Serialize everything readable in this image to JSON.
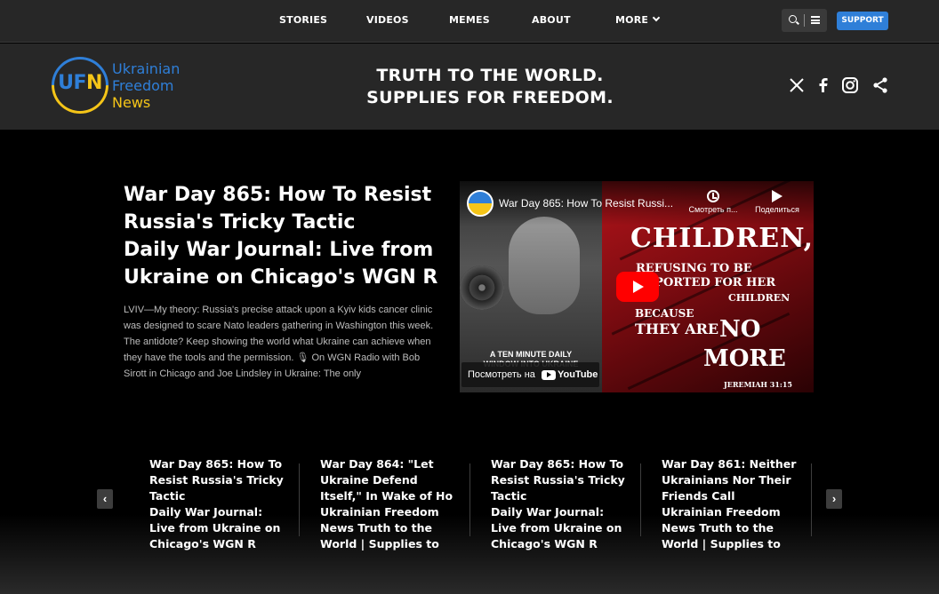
{
  "topnav": {
    "items": [
      "STORIES",
      "VIDEOS",
      "MEMES",
      "ABOUT",
      "MORE"
    ],
    "support_label": "SUPPORT"
  },
  "header": {
    "logo": {
      "initials_1": "U",
      "initials_2": "F",
      "initials_3": "N",
      "line1": "Ukrainian",
      "line2": "Freedom",
      "line3": "News"
    },
    "tagline_line1": "TRUTH TO THE WORLD.",
    "tagline_line2": "SUPPLIES FOR FREEDOM.",
    "social": [
      "x-icon",
      "facebook-icon",
      "instagram-icon",
      "share-icon"
    ]
  },
  "hero": {
    "title_lines": [
      "War Day 865: How To Resist",
      "Russia's Tricky Tactic",
      "Daily War Journal: Live from",
      "Ukraine on Chicago's WGN R"
    ],
    "body": "LVIV—My theory: Russia's precise attack upon a Kyiv kids cancer clinic was designed to scare Nato leaders gathering in Washington this week. The antidote? Keep showing the world what Ukraine can achieve when they have the tools and the permission. 🎙 On WGN Radio with Bob Sirott in Chicago and Joe Lindsley in Ukraine: The only"
  },
  "video": {
    "title": "War Day 865: How To Resist Russi...",
    "watch_later": "Смотреть п...",
    "share": "Поделиться",
    "watch_on": "Посмотреть на",
    "youtube_word": "YouTube",
    "left_caption_1": "A TEN MINUTE DAILY",
    "left_caption_2": "WINDOW INTO UKRAINE",
    "poster": {
      "p1": "CHILDREN,",
      "p2": "REFUSING TO BE",
      "p3": "DEPORTED FOR HER",
      "p4": "CHILDREN",
      "p5": "BECAUSE",
      "p6": "THEY ARE",
      "p7": "NO",
      "p8": "MORE",
      "p9": "JEREMIAH 31:15"
    }
  },
  "carousel": {
    "prev_label": "‹",
    "next_label": "›",
    "cards": [
      {
        "lines": [
          "War Day 865: How To",
          "Resist Russia's Tricky",
          "Tactic",
          "Daily War Journal:",
          "Live from Ukraine on",
          "Chicago's WGN R"
        ]
      },
      {
        "lines": [
          "War Day 864: \"Let",
          "Ukraine Defend",
          "Itself,\" In Wake of Ho",
          "Ukrainian Freedom",
          "News Truth to the",
          "World | Supplies to"
        ]
      },
      {
        "lines": [
          "War Day 865: How To",
          "Resist Russia's Tricky",
          "Tactic",
          "Daily War Journal:",
          "Live from Ukraine on",
          "Chicago's WGN R"
        ]
      },
      {
        "lines": [
          "War Day 861: Neither",
          "Ukrainians Nor Their",
          "Friends Call",
          "Ukrainian Freedom",
          "News Truth to the",
          "World | Supplies to"
        ]
      }
    ]
  },
  "colors": {
    "blue": "#2f7fd8",
    "yellow": "#f5c518",
    "header_bg": "#272727",
    "youtube_red": "#ff0000"
  }
}
